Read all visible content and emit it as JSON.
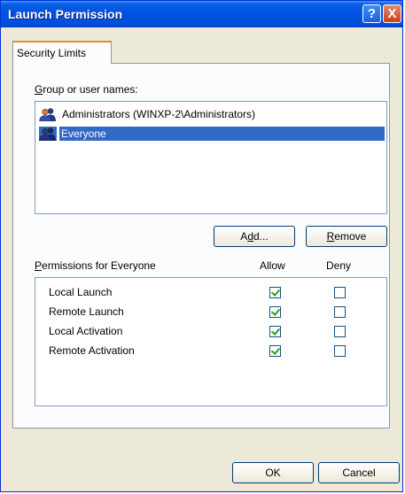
{
  "window": {
    "title": "Launch Permission",
    "help_icon": "?",
    "close_icon": "X"
  },
  "tabs": [
    {
      "label": "Security Limits"
    }
  ],
  "group_section": {
    "label_accel": "G",
    "label_rest": "roup or user names:",
    "items": [
      {
        "name": "Administrators (WINXP-2\\Administrators)",
        "icon": "users-icon",
        "selected": false
      },
      {
        "name": "Everyone",
        "icon": "users-icon",
        "selected": true
      }
    ]
  },
  "buttons": {
    "add_pre": "A",
    "add_accel": "d",
    "add_post": "d...",
    "remove_accel": "R",
    "remove_rest": "emove",
    "ok": "OK",
    "cancel": "Cancel"
  },
  "permissions": {
    "label_accel": "P",
    "label_rest": "ermissions for Everyone",
    "allow_header": "Allow",
    "deny_header": "Deny",
    "rows": [
      {
        "name": "Local Launch",
        "allow": true,
        "deny": false
      },
      {
        "name": "Remote Launch",
        "allow": true,
        "deny": false
      },
      {
        "name": "Local Activation",
        "allow": true,
        "deny": false
      },
      {
        "name": "Remote Activation",
        "allow": true,
        "deny": false
      }
    ]
  },
  "colors": {
    "titlebar": "#0054e3",
    "selection": "#316ac5",
    "checkmark": "#21a121",
    "tab_highlight": "#e68b2c"
  }
}
